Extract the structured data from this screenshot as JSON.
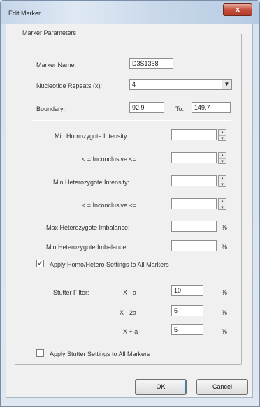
{
  "window": {
    "title": "Edit Marker",
    "close_label": "x"
  },
  "group": {
    "label": "Marker Parameters"
  },
  "marker_name": {
    "label": "Marker Name:",
    "value": "D3S1358"
  },
  "nucleotide_repeats": {
    "label": "Nucleotide Repeats (x):",
    "value": "4"
  },
  "boundary": {
    "label": "Boundary:",
    "from": "92.9",
    "to_label": "To:",
    "to": "149.7"
  },
  "intensity": {
    "min_homo_label": "Min Homozygote Intensity:",
    "inconclusive_label_1": "< = Inconclusive <=",
    "min_hetero_label": "Min Heterozygote Intensity:",
    "inconclusive_label_2": "< = Inconclusive <=",
    "max_hetero_imbalance_label": "Max Heterozygote Imbalance:",
    "min_hetero_imbalance_label": "Min Heterozygote Imbalance:",
    "percent": "%"
  },
  "apply_homo": {
    "label": "Apply Homo/Hetero Settings to All Markers",
    "checked_glyph": "✓"
  },
  "stutter": {
    "label": "Stutter Filter:",
    "row1_label": "X - a",
    "row1_value": "10",
    "row2_label": "X - 2a",
    "row2_value": "5",
    "row3_label": "X + a",
    "row3_value": "5",
    "percent": "%"
  },
  "apply_stutter": {
    "label": "Apply Stutter Settings to All Markers"
  },
  "buttons": {
    "ok": "OK",
    "cancel": "Cancel"
  }
}
